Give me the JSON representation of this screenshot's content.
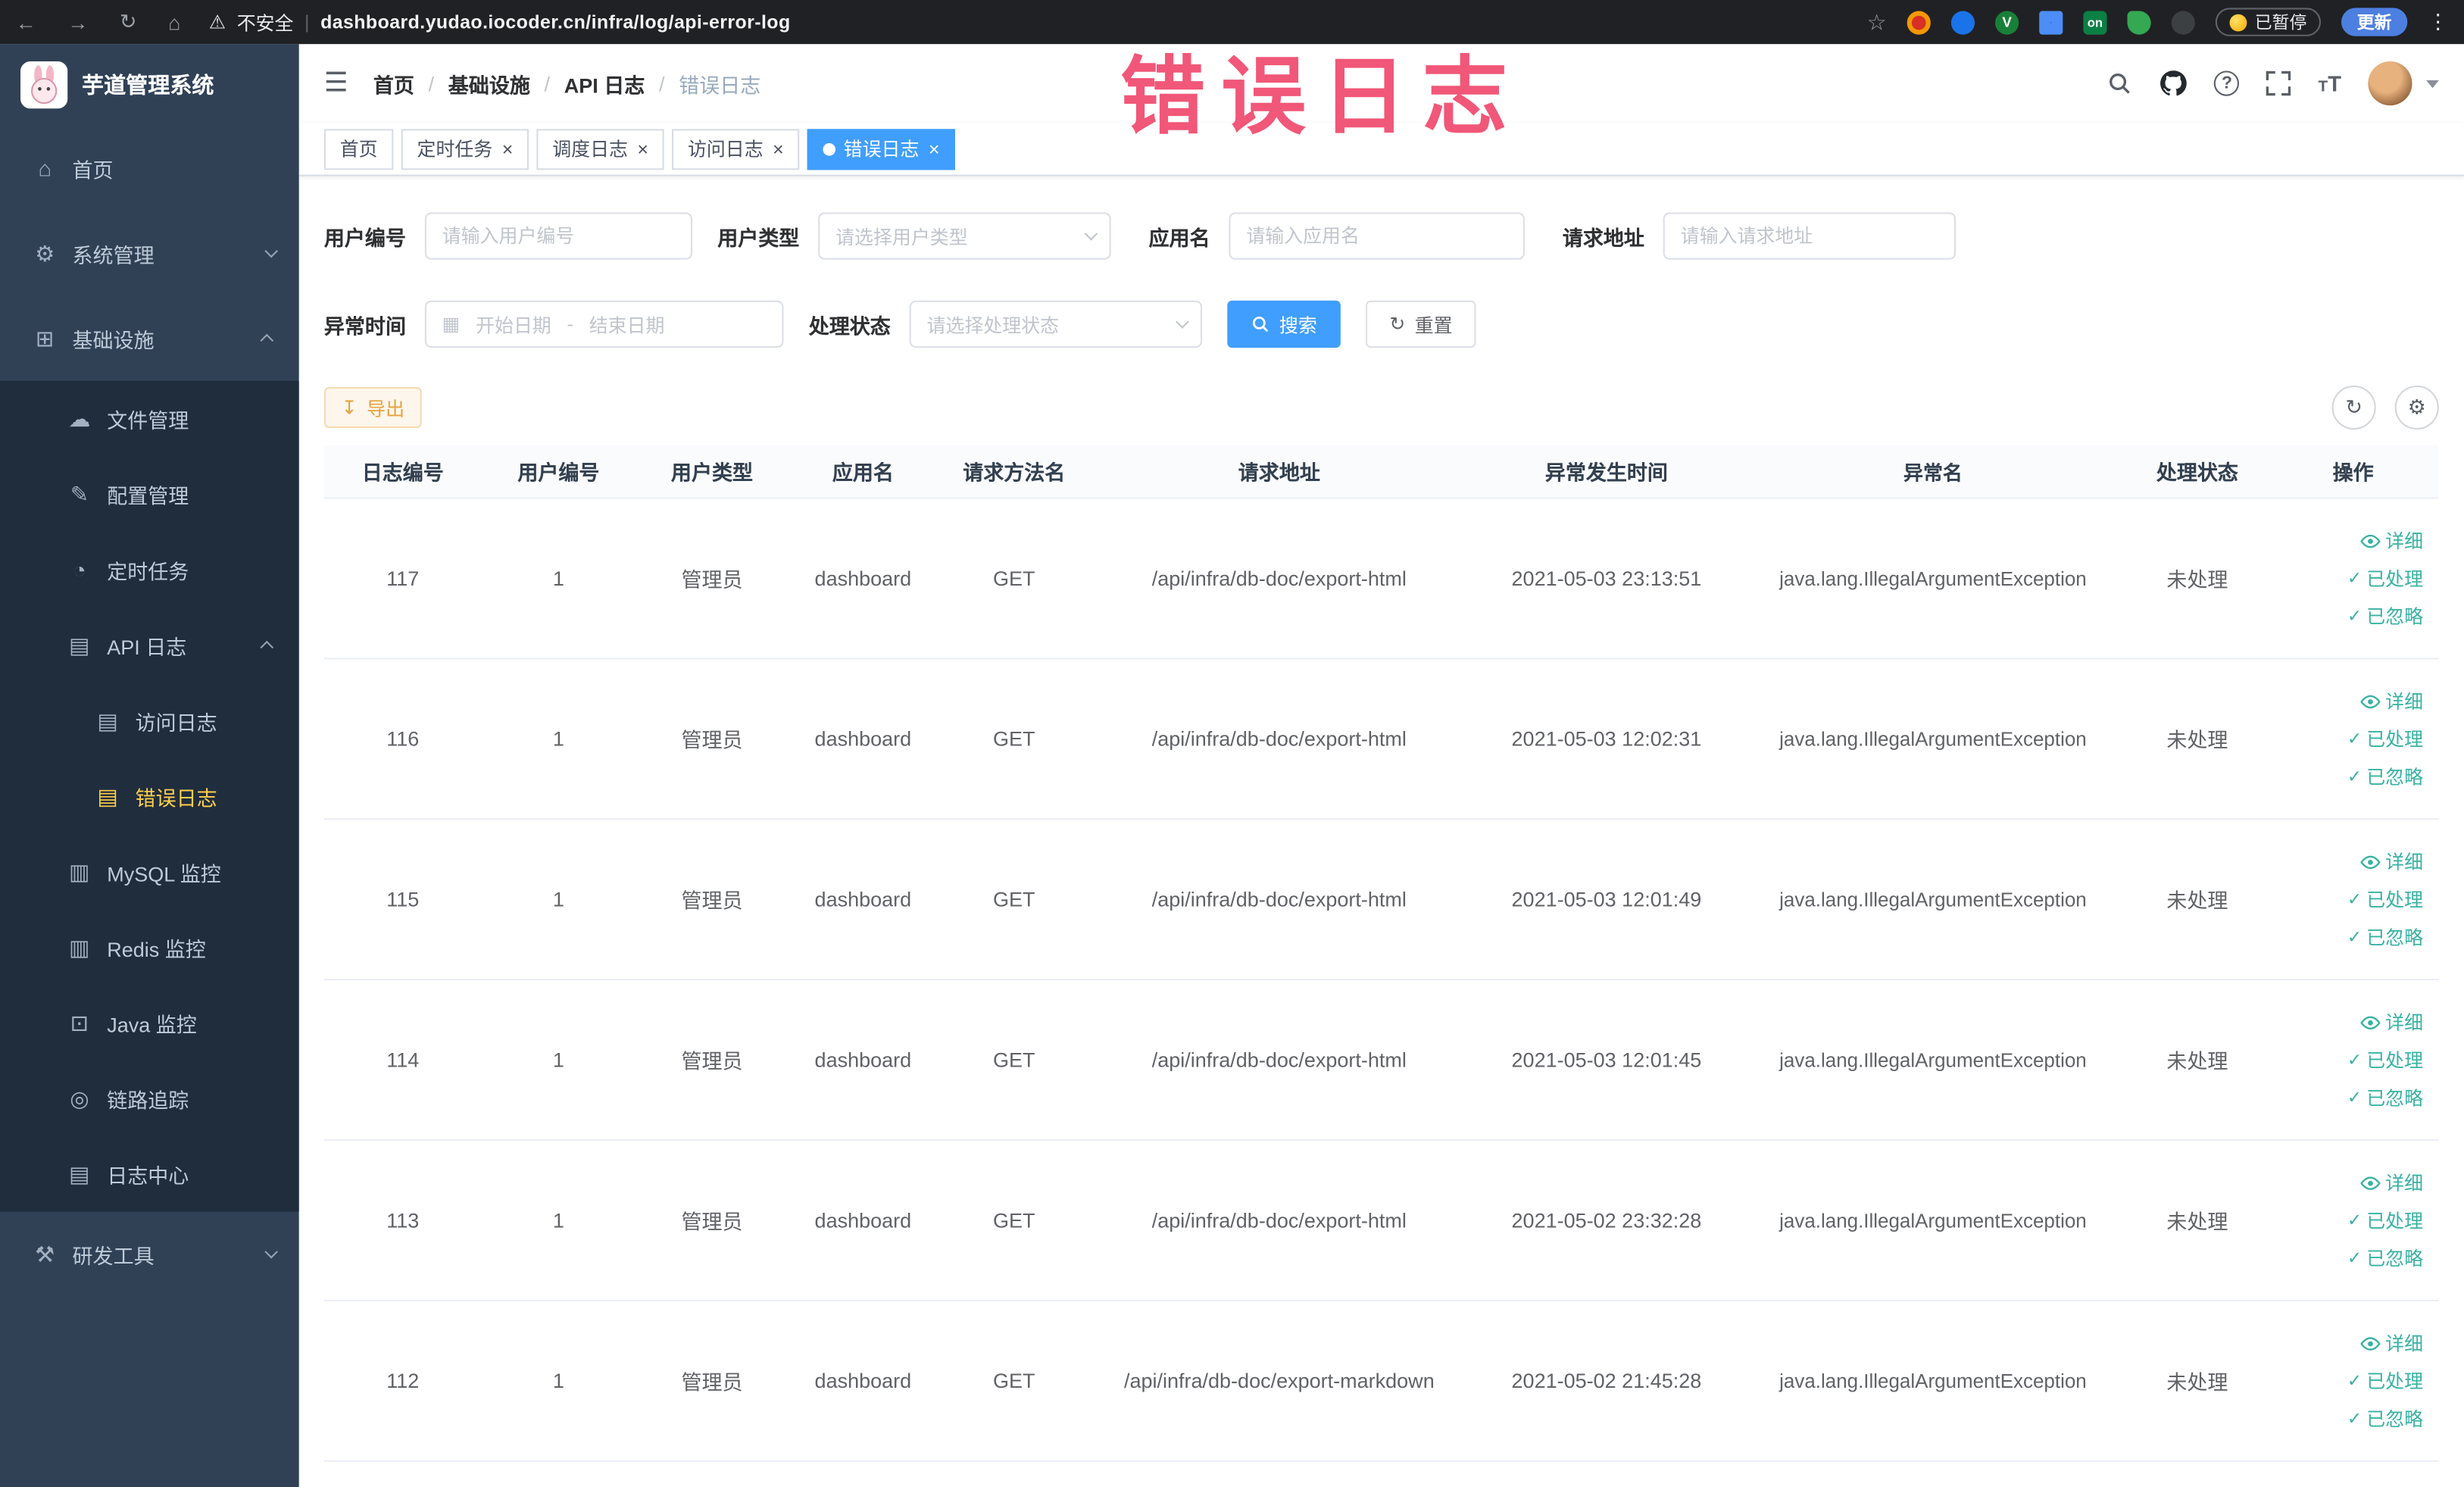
{
  "browser": {
    "security": "不安全",
    "url": "dashboard.yudao.iocoder.cn/infra/log/api-error-log",
    "on_badge": "on",
    "paused": "已暂停",
    "update": "更新"
  },
  "annotation": {
    "text": "错误日志"
  },
  "sidebar": {
    "logo": "芋道管理系统",
    "items": [
      {
        "label": "首页"
      },
      {
        "label": "系统管理"
      },
      {
        "label": "基础设施"
      },
      {
        "label": "文件管理"
      },
      {
        "label": "配置管理"
      },
      {
        "label": "定时任务"
      },
      {
        "label": "API 日志"
      },
      {
        "label": "访问日志"
      },
      {
        "label": "错误日志"
      },
      {
        "label": "MySQL 监控"
      },
      {
        "label": "Redis 监控"
      },
      {
        "label": "Java 监控"
      },
      {
        "label": "链路追踪"
      },
      {
        "label": "日志中心"
      },
      {
        "label": "研发工具"
      }
    ]
  },
  "breadcrumb": {
    "separator": "/",
    "items": [
      "首页",
      "基础设施",
      "API 日志",
      "错误日志"
    ]
  },
  "tabs": [
    {
      "label": "首页"
    },
    {
      "label": "定时任务"
    },
    {
      "label": "调度日志"
    },
    {
      "label": "访问日志"
    },
    {
      "label": "错误日志"
    }
  ],
  "filters": {
    "user_id_label": "用户编号",
    "user_id_placeholder": "请输入用户编号",
    "user_type_label": "用户类型",
    "user_type_placeholder": "请选择用户类型",
    "app_label": "应用名",
    "app_placeholder": "请输入应用名",
    "req_url_label": "请求地址",
    "req_url_placeholder": "请输入请求地址",
    "time_label": "异常时间",
    "time_start": "开始日期",
    "time_separator": "-",
    "time_end": "结束日期",
    "status_label": "处理状态",
    "status_placeholder": "请选择处理状态",
    "search": "搜索",
    "reset": "重置"
  },
  "toolbar": {
    "export": "导出"
  },
  "table": {
    "columns": [
      "日志编号",
      "用户编号",
      "用户类型",
      "应用名",
      "请求方法名",
      "请求地址",
      "异常发生时间",
      "异常名",
      "处理状态",
      "操作"
    ],
    "actions": {
      "detail": "详细",
      "processed": "已处理",
      "ignored": "已忽略"
    },
    "rows": [
      {
        "id": "117",
        "user": "1",
        "type": "管理员",
        "app": "dashboard",
        "method": "GET",
        "url": "/api/infra/db-doc/export-html",
        "time": "2021-05-03 23:13:51",
        "exception": "java.lang.IllegalArgumentException",
        "status": "未处理"
      },
      {
        "id": "116",
        "user": "1",
        "type": "管理员",
        "app": "dashboard",
        "method": "GET",
        "url": "/api/infra/db-doc/export-html",
        "time": "2021-05-03 12:02:31",
        "exception": "java.lang.IllegalArgumentException",
        "status": "未处理"
      },
      {
        "id": "115",
        "user": "1",
        "type": "管理员",
        "app": "dashboard",
        "method": "GET",
        "url": "/api/infra/db-doc/export-html",
        "time": "2021-05-03 12:01:49",
        "exception": "java.lang.IllegalArgumentException",
        "status": "未处理"
      },
      {
        "id": "114",
        "user": "1",
        "type": "管理员",
        "app": "dashboard",
        "method": "GET",
        "url": "/api/infra/db-doc/export-html",
        "time": "2021-05-03 12:01:45",
        "exception": "java.lang.IllegalArgumentException",
        "status": "未处理"
      },
      {
        "id": "113",
        "user": "1",
        "type": "管理员",
        "app": "dashboard",
        "method": "GET",
        "url": "/api/infra/db-doc/export-html",
        "time": "2021-05-02 23:32:28",
        "exception": "java.lang.IllegalArgumentException",
        "status": "未处理"
      },
      {
        "id": "112",
        "user": "1",
        "type": "管理员",
        "app": "dashboard",
        "method": "GET",
        "url": "/api/infra/db-doc/export-markdown",
        "time": "2021-05-02 21:45:28",
        "exception": "java.lang.IllegalArgumentException",
        "status": "未处理"
      }
    ]
  },
  "colors": {
    "accent_blue": "#409eff",
    "sidebar_bg": "#304156",
    "submenu_bg": "#1f2d3d",
    "active_menu_text": "#ffd04b",
    "export_warning": "#e6a23c",
    "action_link_teal": "#38b2a3",
    "annotation_red": "#ee3a60"
  }
}
